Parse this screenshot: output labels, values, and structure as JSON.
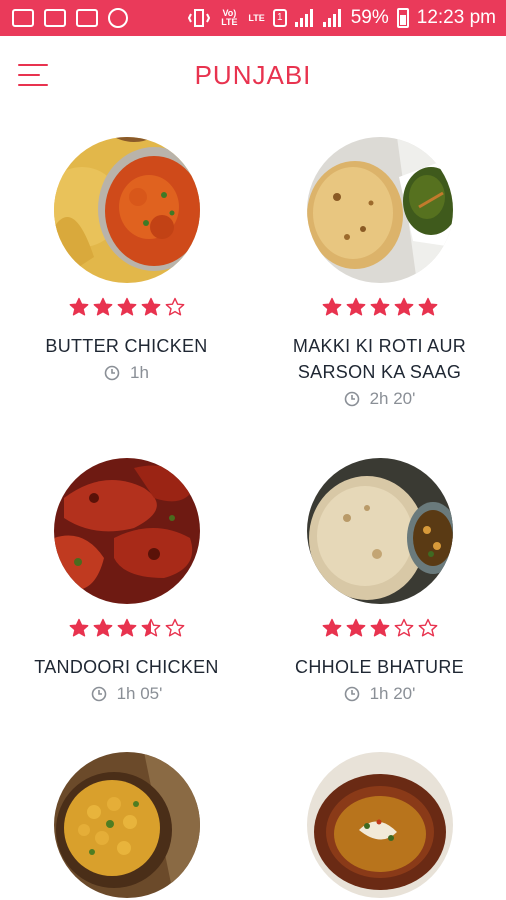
{
  "status_bar": {
    "battery": "59%",
    "time": "12:23 pm",
    "volte": "Vo) LTE",
    "lte": "LTE",
    "sim": "1"
  },
  "header": {
    "title": "PUNJABI",
    "menu_icon": "hamburger-menu-icon"
  },
  "accent_color": "#e8334f",
  "recipes": [
    {
      "name": "BUTTER CHICKEN",
      "time": "1h",
      "rating": 4
    },
    {
      "name": "MAKKI KI ROTI AUR SARSON KA SAAG",
      "time": "2h 20'",
      "rating": 5
    },
    {
      "name": "TANDOORI CHICKEN",
      "time": "1h 05'",
      "rating": 3.5
    },
    {
      "name": "CHHOLE BHATURE",
      "time": "1h 20'",
      "rating": 3
    },
    {
      "name": "",
      "time": "",
      "rating": null
    },
    {
      "name": "",
      "time": "",
      "rating": null
    }
  ]
}
